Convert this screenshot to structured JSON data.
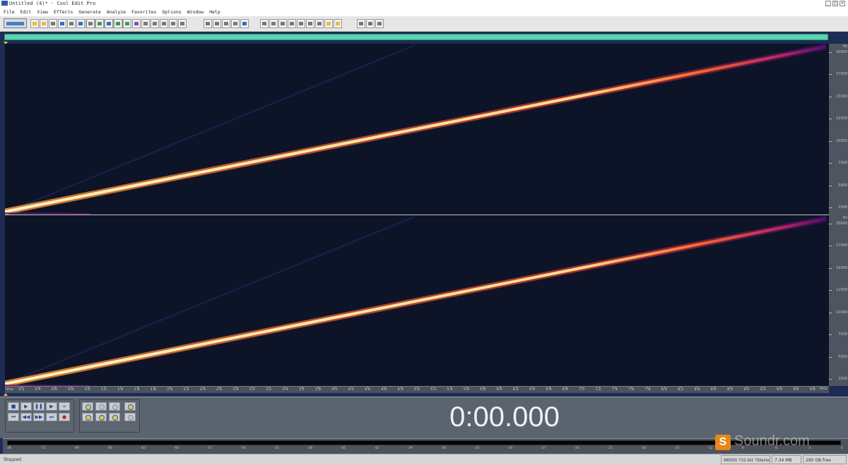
{
  "window": {
    "title": "Untitled (4)* - Cool Edit Pro"
  },
  "menu": [
    "File",
    "Edit",
    "View",
    "Effects",
    "Generate",
    "Analyze",
    "Favorites",
    "Options",
    "Window",
    "Help"
  ],
  "toolbar": {
    "button_count": 38
  },
  "spectral": {
    "frequency_axis_top": {
      "unit": "Hz",
      "labels": [
        "20000",
        "17500",
        "15000",
        "12500",
        "10000",
        "7500",
        "5000",
        "2500"
      ]
    },
    "frequency_axis_bottom": {
      "unit": "Hz",
      "labels": [
        "20000",
        "17500",
        "15000",
        "12500",
        "10000",
        "7500",
        "5000",
        "2500"
      ]
    },
    "sweep_color": "#ffe8b0"
  },
  "time_ruler": {
    "start_label": "hms",
    "end_label": "hms",
    "labels": [
      "0.2",
      "0.4",
      "0.6",
      "0.8",
      "1.0",
      "1.2",
      "1.4",
      "1.6",
      "1.8",
      "2.0",
      "2.2",
      "2.4",
      "2.6",
      "2.8",
      "3.0",
      "3.2",
      "3.4",
      "3.6",
      "3.8",
      "4.0",
      "4.2",
      "4.4",
      "4.6",
      "4.8",
      "5.0",
      "5.2",
      "5.4",
      "5.6",
      "5.8",
      "6.0",
      "6.2",
      "6.4",
      "6.6",
      "6.8",
      "7.0",
      "7.2",
      "7.4",
      "7.6",
      "7.8",
      "8.0",
      "8.2",
      "8.4",
      "8.6",
      "8.8",
      "9.0",
      "9.2",
      "9.4",
      "9.6",
      "9.8"
    ]
  },
  "transport": {
    "buttons": [
      {
        "name": "stop-button",
        "glyph": "■"
      },
      {
        "name": "play-button",
        "glyph": "▶"
      },
      {
        "name": "pause-button",
        "glyph": "❚❚"
      },
      {
        "name": "play-to-end-button",
        "glyph": "▶"
      },
      {
        "name": "loop-button",
        "glyph": "∞"
      },
      {
        "name": "go-to-start-button",
        "glyph": "⏮"
      },
      {
        "name": "rewind-button",
        "glyph": "◀◀"
      },
      {
        "name": "fast-forward-button",
        "glyph": "▶▶"
      },
      {
        "name": "go-to-end-button",
        "glyph": "⏭"
      },
      {
        "name": "record-button",
        "glyph": "●"
      }
    ]
  },
  "time_display": "0:00.000",
  "level_meter": {
    "labels": [
      "dB",
      "-72",
      "-69",
      "-66",
      "-63",
      "-60",
      "-57",
      "-54",
      "-51",
      "-48",
      "-45",
      "-42",
      "-39",
      "-36",
      "-33",
      "-30",
      "-27",
      "-24",
      "-21",
      "-18",
      "-15",
      "-12",
      "-9",
      "-6",
      "-3",
      "0"
    ]
  },
  "watermark": {
    "logo": "S",
    "text": "Soundr.com"
  },
  "status": {
    "state": "Stopped",
    "format": "96000 ?32-bit ?Stereo",
    "size": "7.34 MB",
    "free": "280 GB free"
  }
}
